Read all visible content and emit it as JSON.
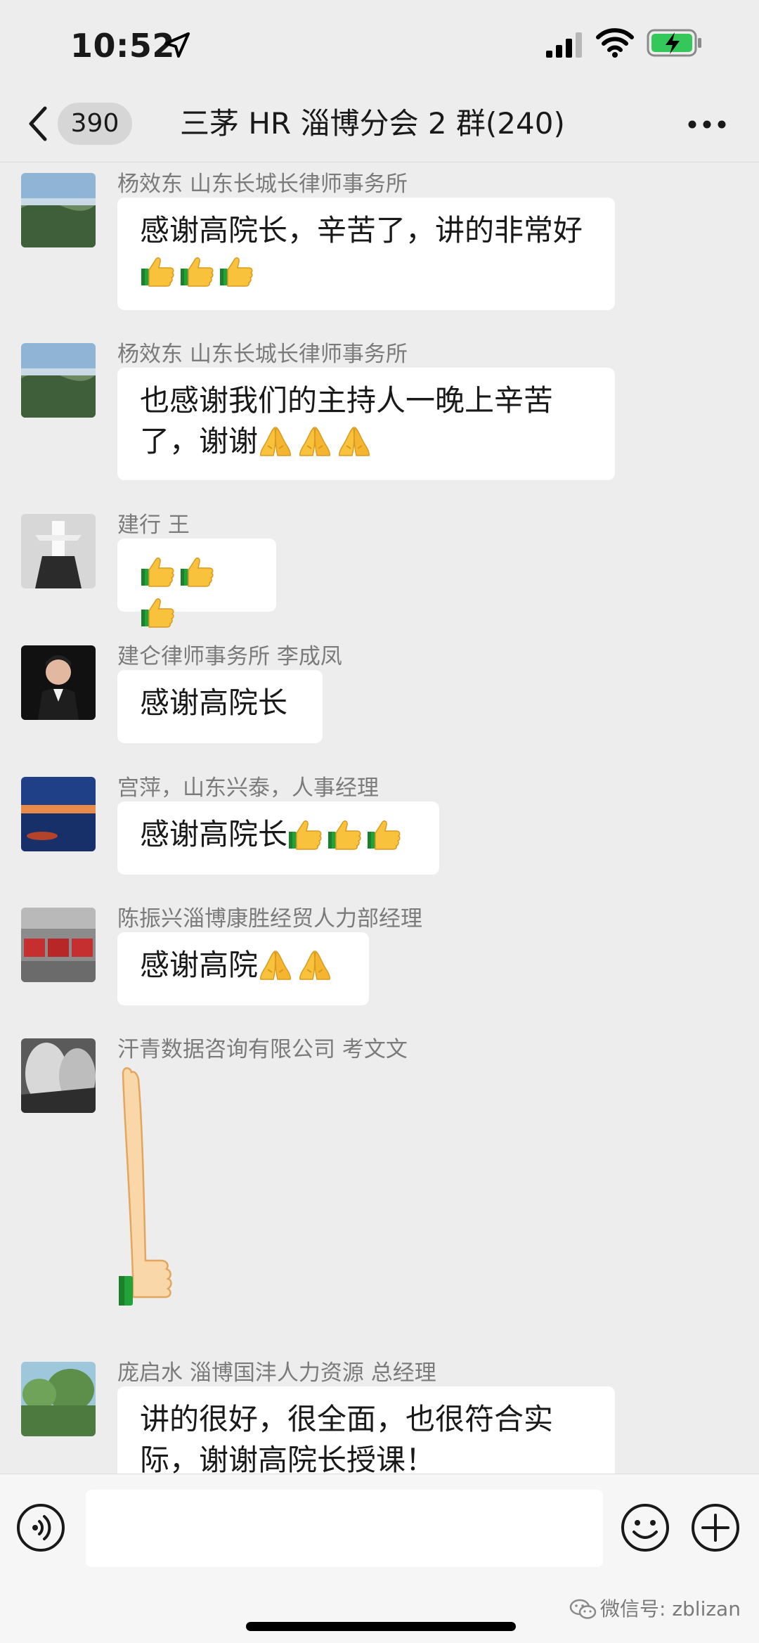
{
  "status_bar": {
    "time": "10:52"
  },
  "nav": {
    "unread_count": "390",
    "title": "三茅 HR 淄博分会 2 群(240)"
  },
  "messages": [
    {
      "sender": "杨效东 山东长城长律师事务所",
      "text": "感谢高院长，辛苦了，讲的非常好",
      "emoji": "thumbs-up-icon"
    },
    {
      "sender": "杨效东 山东长城长律师事务所",
      "text": "也感谢我们的主持人一晚上辛苦了，谢谢",
      "emoji": "pray-icon"
    },
    {
      "sender": "建行 王",
      "text": "",
      "emoji": "thumbs-up-icon"
    },
    {
      "sender": "建仑律师事务所 李成凤",
      "text": "感谢高院长"
    },
    {
      "sender": "宫萍，山东兴泰，人事经理",
      "text": "感谢高院长",
      "emoji": "thumbs-up-icon"
    },
    {
      "sender": "陈振兴淄博康胜经贸人力部经理",
      "text": "感谢高院",
      "emoji": "pray-icon"
    },
    {
      "sender": "汗青数据咨询有限公司 考文文",
      "sticker": "long-thumbs-up-sticker"
    },
    {
      "sender": "庞启水 淄博国沣人力资源 总经理",
      "text": "讲的很好，很全面，也很符合实际，谢谢高院长授课！"
    }
  ],
  "watermark": "微信号: zblizan"
}
